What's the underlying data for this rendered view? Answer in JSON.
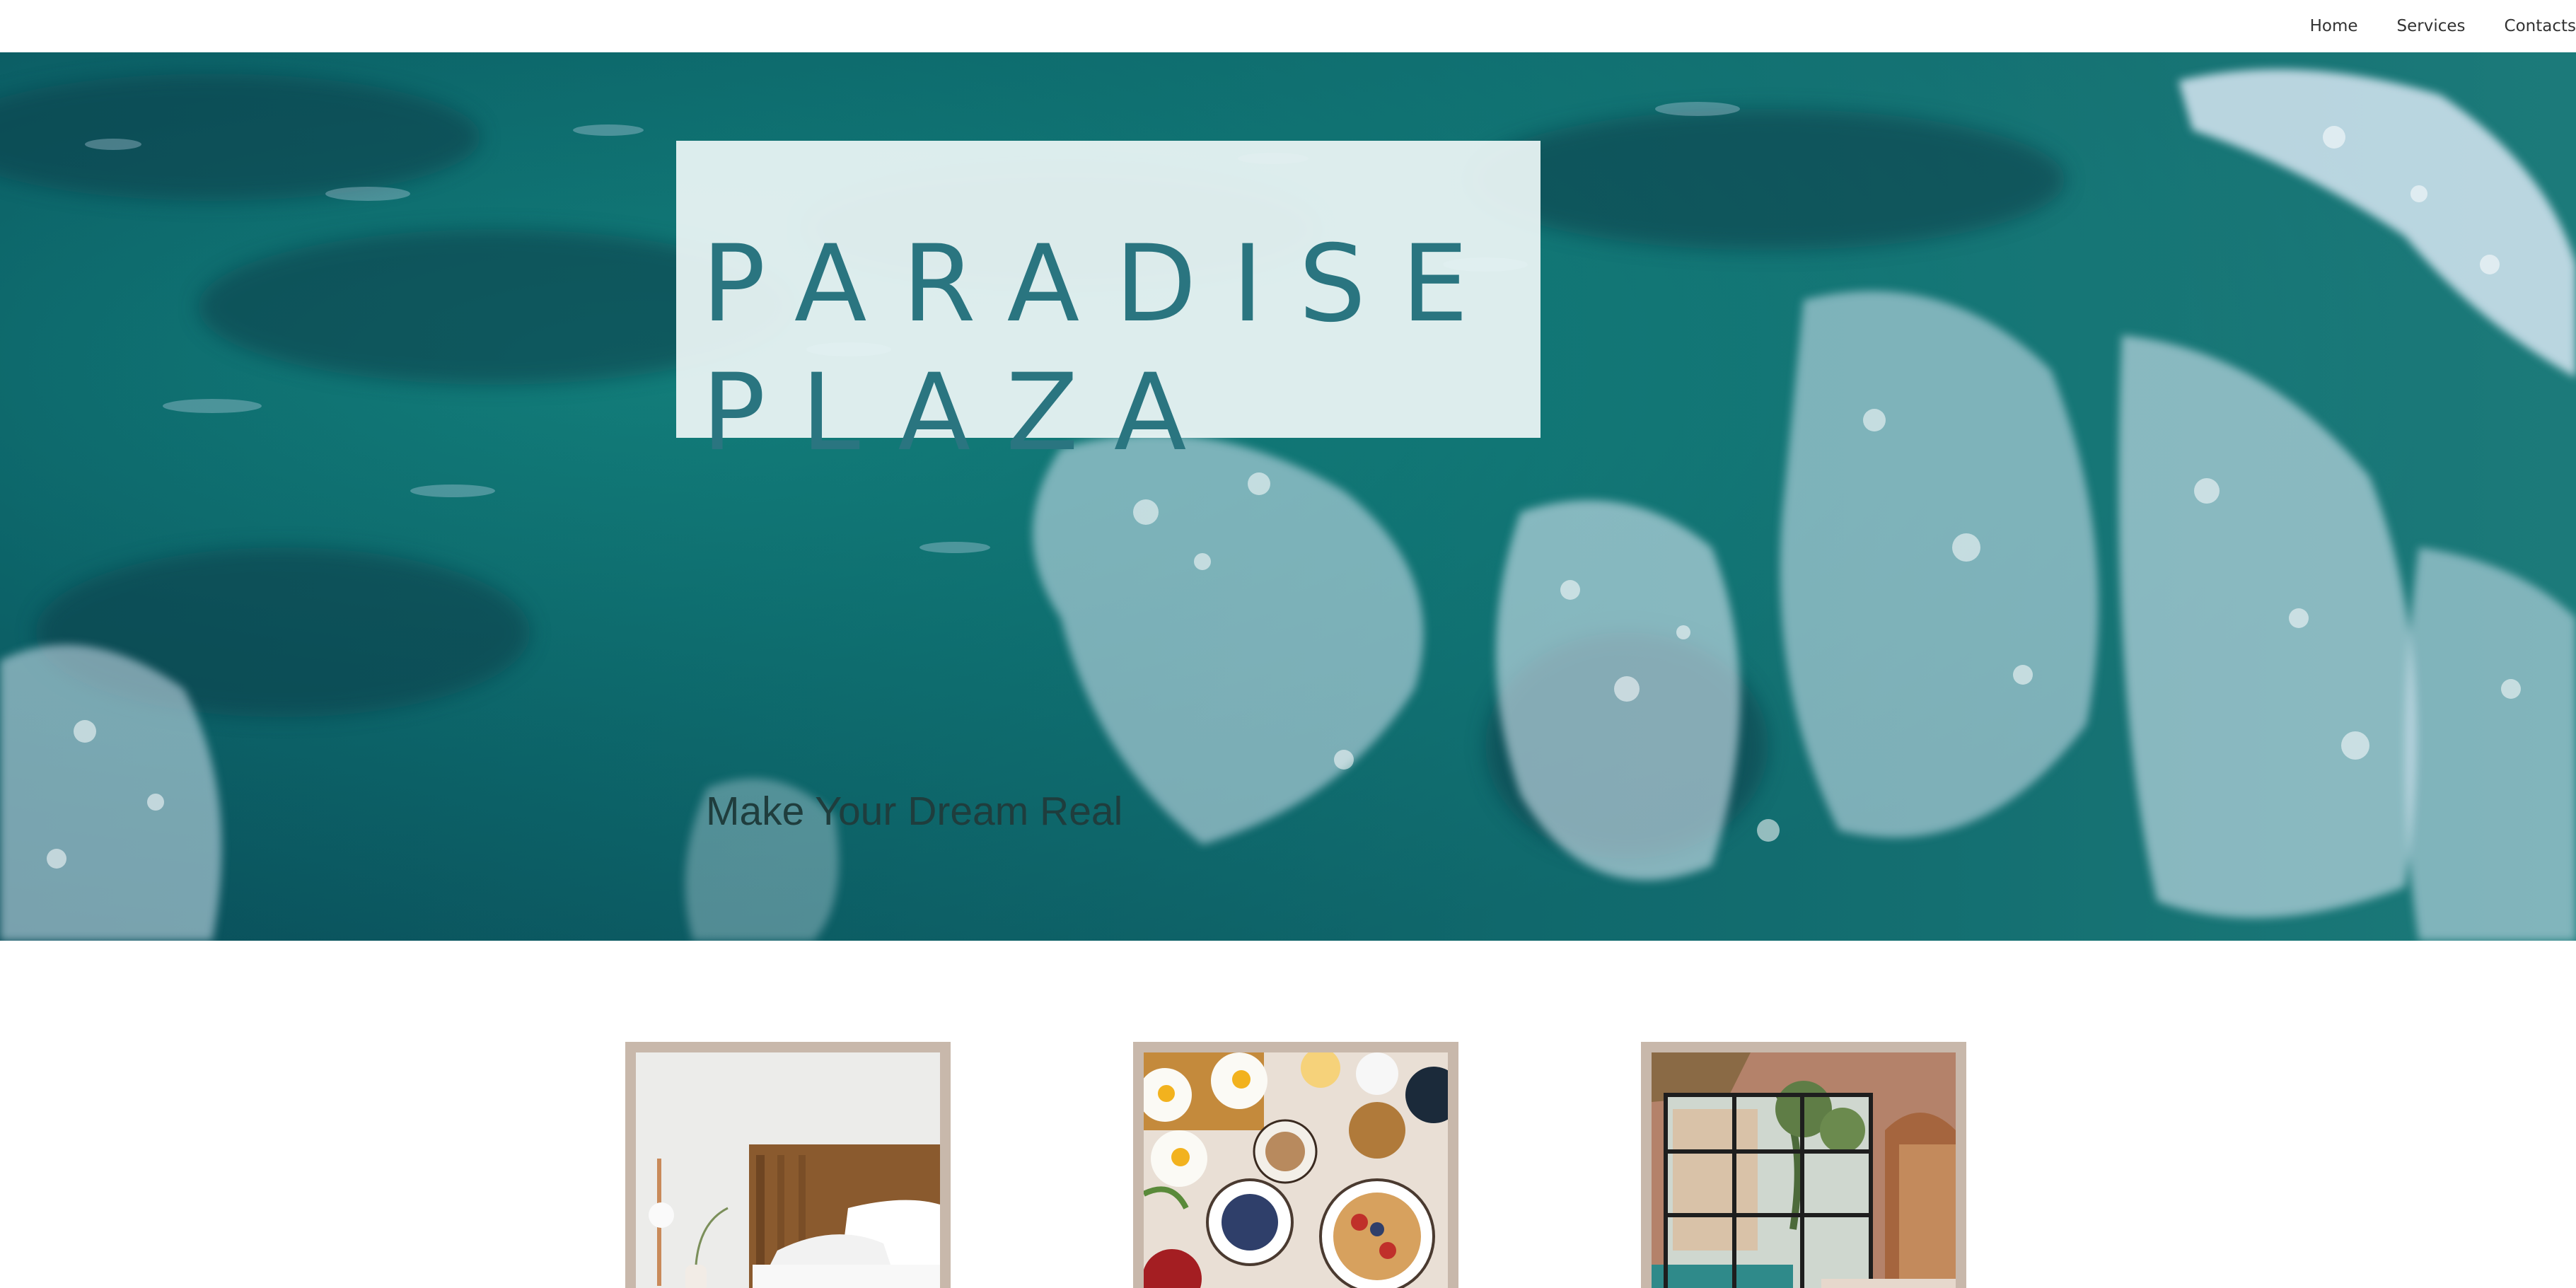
{
  "nav": {
    "items": [
      "Home",
      "Services",
      "Contacts"
    ]
  },
  "hero": {
    "title_line1": "PARADISE",
    "title_line2": "PLAZA",
    "tagline": "Make Your Dream Real",
    "background": "ocean-waves-aerial-photo"
  },
  "cards": [
    {
      "image": "bedroom-photo"
    },
    {
      "image": "breakfast-table-photo"
    },
    {
      "image": "pool-villa-interior-photo"
    }
  ],
  "colors": {
    "title_text": "#2a7580",
    "ocean": "#0b5f64",
    "card_frame": "#c8b8ab"
  }
}
